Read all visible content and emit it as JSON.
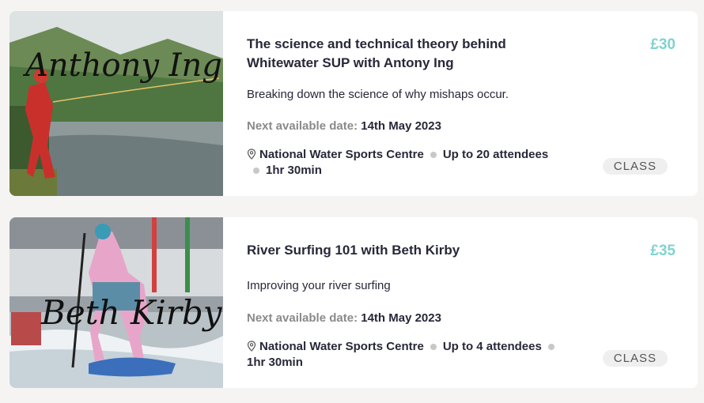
{
  "next_label": "Next available date:",
  "cards": [
    {
      "title": "The science and technical theory behind Whitewater SUP with Antony Ing",
      "price": "£30",
      "description": "Breaking down the science of why mishaps occur.",
      "next_date": "14th May 2023",
      "location": "National Water Sports Centre",
      "attendees": "Up to 20 attendees",
      "duration": "1hr 30min",
      "type": "CLASS",
      "image_signature": "Anthony Ing"
    },
    {
      "title": "River Surfing 101 with Beth Kirby",
      "price": "£35",
      "description": "Improving your river surfing",
      "next_date": "14th May 2023",
      "location": "National Water Sports Centre",
      "attendees": "Up to 4 attendees",
      "duration": "1hr 30min",
      "type": "CLASS",
      "image_signature": "Beth Kirby"
    }
  ],
  "colors": {
    "price": "#7fd3cf",
    "text": "#272838",
    "muted": "#8a8a8a",
    "badge_bg": "#efefef"
  },
  "icons": {
    "location": "map-pin-icon"
  }
}
